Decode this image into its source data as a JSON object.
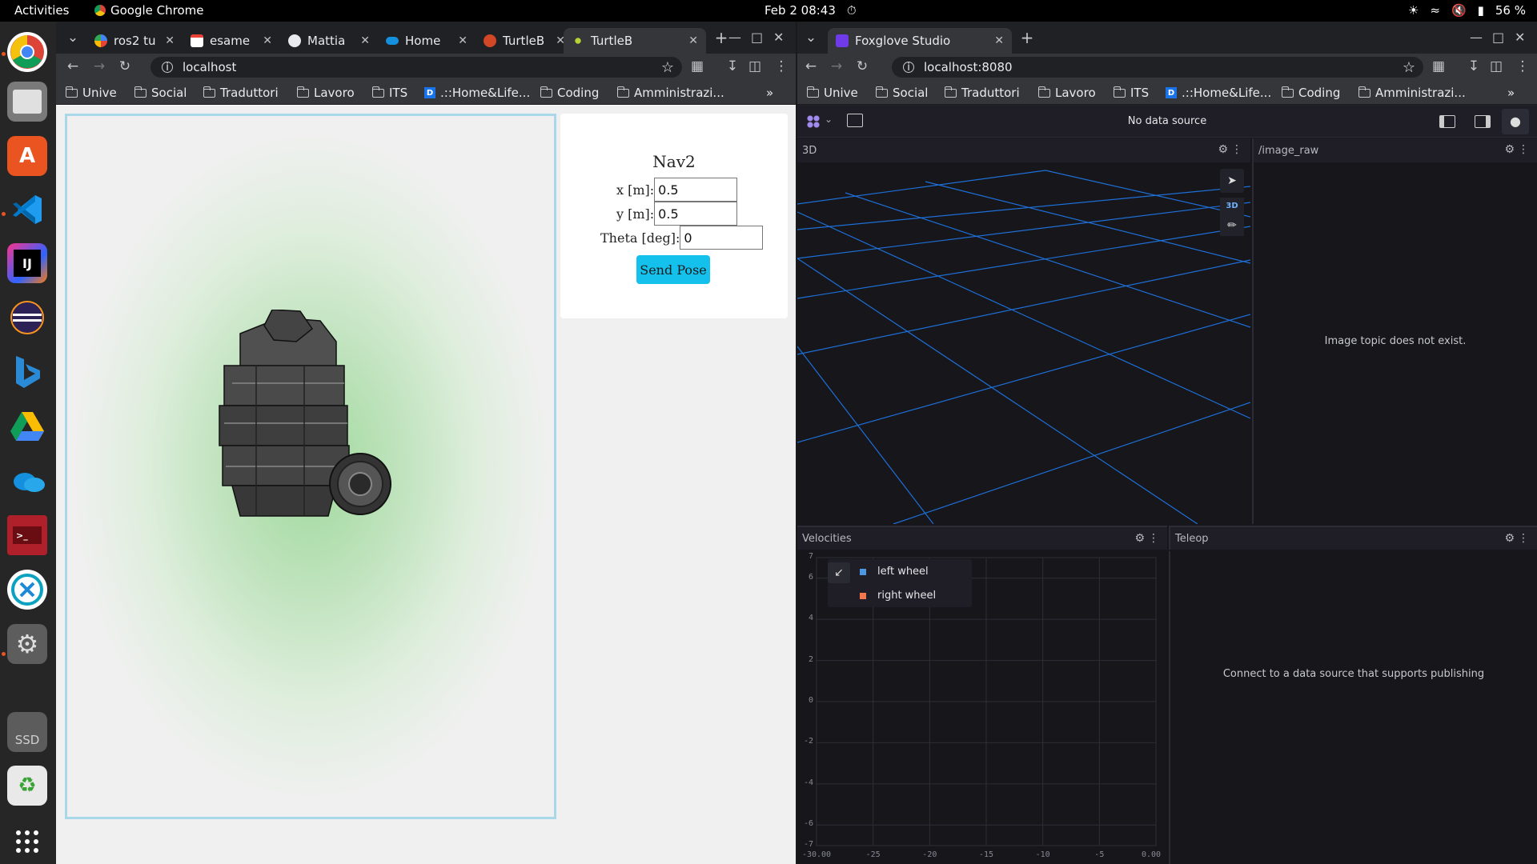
{
  "topbar": {
    "activities": "Activities",
    "app_name": "Google Chrome",
    "date": "Feb 2",
    "time": "08:43",
    "battery": "56 %"
  },
  "dock": {
    "items": [
      "chrome-icon",
      "files-icon",
      "app-center-icon",
      "vscode-icon",
      "intellij-icon",
      "eclipse-icon",
      "bing-icon",
      "google-drive-icon",
      "onedrive-icon",
      "terminal-icon",
      "remote-desktop-icon",
      "settings-icon",
      "ssd-icon",
      "trash-icon",
      "app-grid-icon"
    ],
    "ssd_label": "SSD"
  },
  "left_window": {
    "tabs": [
      {
        "label": "ros2 tu",
        "icon": "google-icon"
      },
      {
        "label": "esame",
        "icon": "gmail-icon"
      },
      {
        "label": "Mattia",
        "icon": "github-icon"
      },
      {
        "label": "Home",
        "icon": "onedrive-icon"
      },
      {
        "label": "TurtleB",
        "icon": "powerpoint-icon"
      },
      {
        "label": "TurtleB",
        "icon": "turtlebot-icon"
      }
    ],
    "url": "localhost",
    "bookmarks": [
      "Unive",
      "Social",
      "Traduttori",
      "Lavoro",
      "ITS",
      ".::Home&Life...",
      "Coding",
      "Amministrazi..."
    ],
    "nav": {
      "title": "Nav2",
      "x_label": "x [m]:",
      "x_value": "0.5",
      "y_label": "y [m]:",
      "y_value": "0.5",
      "theta_label": "Theta [deg]:",
      "theta_value": "0",
      "send_label": "Send Pose"
    }
  },
  "right_window": {
    "tab_label": "Foxglove Studio",
    "url": "localhost:8080",
    "bookmarks": [
      "Unive",
      "Social",
      "Traduttori",
      "Lavoro",
      "ITS",
      ".::Home&Life...",
      "Coding",
      "Amministrazi..."
    ],
    "foxglove": {
      "data_source": "No data source",
      "panel_3d_title": "3D",
      "badge_3d": "3D",
      "image_panel_title": "/image_raw",
      "image_msg": "Image topic does not exist.",
      "velocities_title": "Velocities",
      "teleop_title": "Teleop",
      "teleop_msg": "Connect to a data source that supports publishing",
      "legend": [
        {
          "label": "left wheel",
          "color": "#4e98e2"
        },
        {
          "label": "right wheel",
          "color": "#f5774d"
        }
      ],
      "y_ticks": [
        "7",
        "6",
        "4",
        "2",
        "0",
        "-2",
        "-4",
        "-6",
        "-7"
      ],
      "x_ticks": [
        "-30.00",
        "-25",
        "-20",
        "-15",
        "-10",
        "-5",
        "0.00"
      ]
    }
  }
}
